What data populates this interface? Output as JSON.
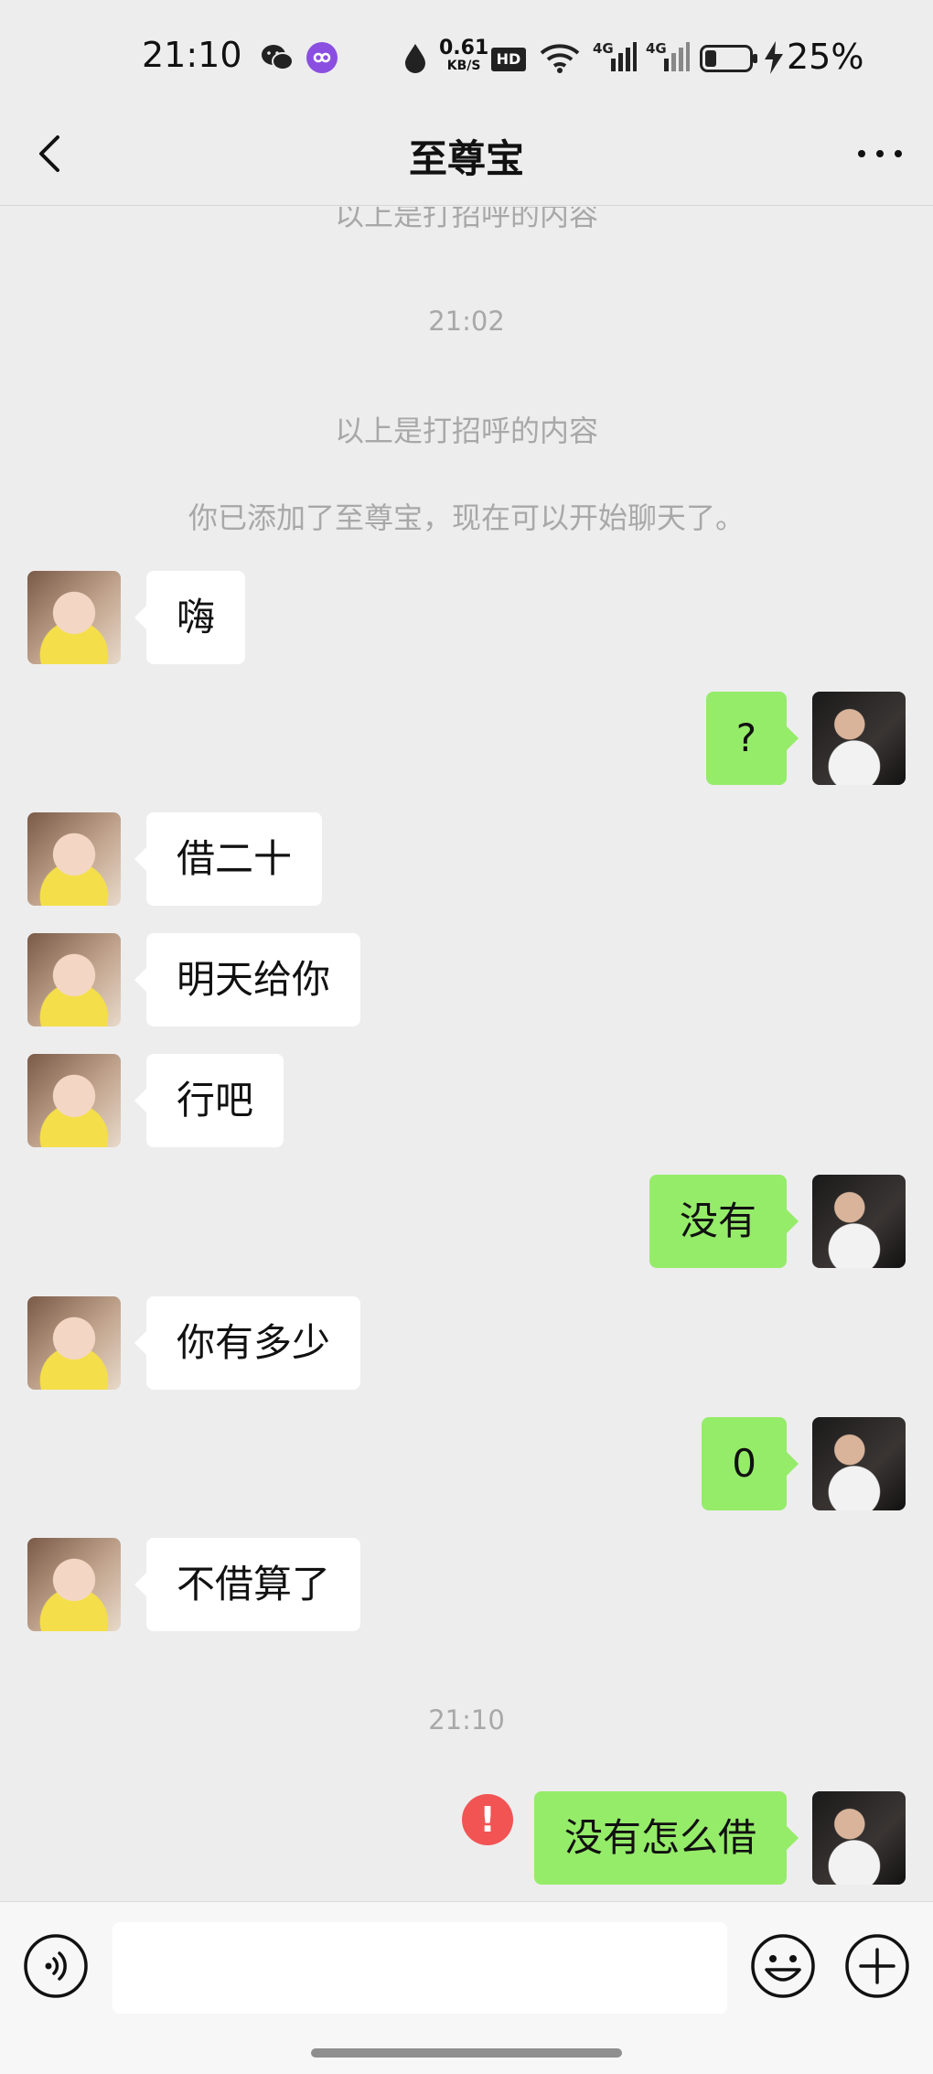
{
  "status_bar": {
    "time": "21:10",
    "net_speed_value": "0.61",
    "net_speed_unit": "KB/S",
    "hd_label": "HD",
    "signal_1_label": "4G",
    "signal_2_label": "4G",
    "battery_percent": "25%",
    "icons": [
      "wechat-icon",
      "link-app-icon",
      "data-drop-icon",
      "hd-icon",
      "wifi-icon",
      "signal-4g-icon",
      "signal-4g-icon",
      "battery-icon",
      "charging-icon"
    ]
  },
  "header": {
    "title": "至尊宝",
    "back_icon": "chevron-left-icon",
    "more_icon": "more-dots-icon"
  },
  "chat": {
    "top_partial_text": "以上是打招呼的内容",
    "time_1": "21:02",
    "greeting_notice": "以上是打招呼的内容",
    "added_notice": "你已添加了至尊宝，现在可以开始聊天了。",
    "time_2": "21:10",
    "messages": [
      {
        "from": "contact",
        "text": "嗨"
      },
      {
        "from": "me",
        "text": "?"
      },
      {
        "from": "contact",
        "text": "借二十"
      },
      {
        "from": "contact",
        "text": "明天给你"
      },
      {
        "from": "contact",
        "text": "行吧"
      },
      {
        "from": "me",
        "text": "没有"
      },
      {
        "from": "contact",
        "text": "你有多少"
      },
      {
        "from": "me",
        "text": "0"
      },
      {
        "from": "contact",
        "text": "不借算了"
      },
      {
        "from": "me",
        "text": "没有怎么借",
        "status": "failed"
      }
    ],
    "error_mark": "!"
  },
  "input_bar": {
    "value": "",
    "voice_icon": "voice-icon",
    "emoji_icon": "emoji-icon",
    "plus_icon": "plus-icon"
  },
  "colors": {
    "background": "#ededed",
    "outgoing_bubble": "#95ec69",
    "incoming_bubble": "#ffffff",
    "error": "#f25454",
    "system_text": "#a8a8a8"
  }
}
